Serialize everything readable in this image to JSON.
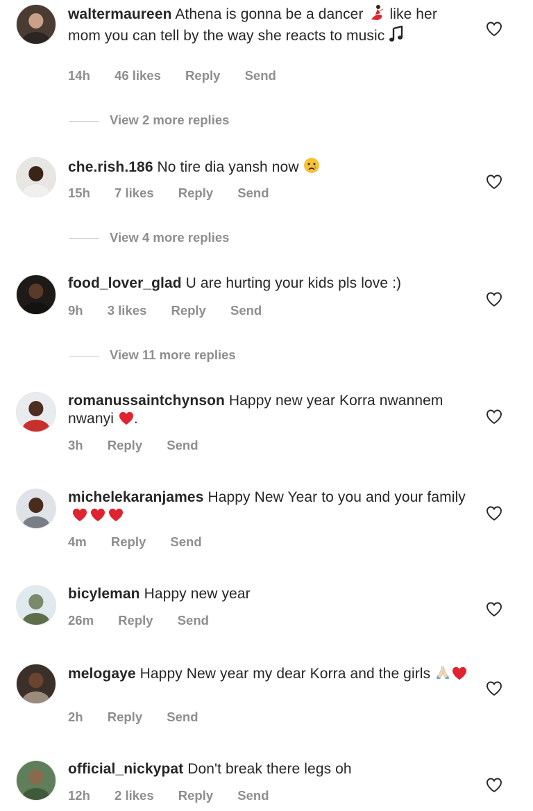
{
  "comments": [
    {
      "username": "waltermaureen",
      "text": "Athena is gonna be a dancer",
      "text_after_emoji": "like her mom  you  can tell by the way she reacts to music",
      "emoji": [
        "dancer-emoji",
        "music-note-emoji"
      ],
      "time": "14h",
      "likes": "46 likes",
      "reply": "Reply",
      "send": "Send",
      "view_replies": "View 2 more replies",
      "avatar_colors": {
        "bg": "#4a3b33",
        "head": "#c9a088",
        "body": "#2a2422"
      }
    },
    {
      "username": "che.rish.186",
      "text": "No tire dia yansh now",
      "emoji": [
        "crying-face-emoji"
      ],
      "time": "15h",
      "likes": "7 likes",
      "reply": "Reply",
      "send": "Send",
      "view_replies": "View 4 more replies",
      "avatar_colors": {
        "bg": "#e8e6e3",
        "head": "#3a2418",
        "body": "#f2f0ee"
      }
    },
    {
      "username": "food_lover_glad",
      "text": "U are hurting your kids pls love :)",
      "time": "9h",
      "likes": "3 likes",
      "reply": "Reply",
      "send": "Send",
      "view_replies": "View 11 more replies",
      "avatar_colors": {
        "bg": "#1e1a18",
        "head": "#5a3a2a",
        "body": "#141211"
      }
    },
    {
      "username": "romanussaintchynson",
      "text": "Happy new year Korra nwannem nwanyi",
      "text_after_emoji": ".",
      "emoji": [
        "red-heart-emoji"
      ],
      "time": "3h",
      "reply": "Reply",
      "send": "Send",
      "avatar_colors": {
        "bg": "#e9ecef",
        "head": "#4e2e20",
        "body": "#c8302c"
      }
    },
    {
      "username": "michelekaranjames",
      "text": "Happy New Year to you and your family",
      "emoji": [
        "red-heart-emoji",
        "red-heart-emoji",
        "red-heart-emoji"
      ],
      "time": "4m",
      "reply": "Reply",
      "send": "Send",
      "avatar_colors": {
        "bg": "#dfe3e8",
        "head": "#4a2c1e",
        "body": "#7a7f87"
      }
    },
    {
      "username": "bicyleman",
      "text": "Happy new year",
      "time": "26m",
      "reply": "Reply",
      "send": "Send",
      "avatar_colors": {
        "bg": "#dfe9ee",
        "head": "#7a8a6a",
        "body": "#5d6e4b"
      }
    },
    {
      "username": "melogaye",
      "text": "Happy New year my dear Korra and the girls",
      "emoji": [
        "folded-hands-emoji",
        "red-heart-emoji"
      ],
      "time": "2h",
      "reply": "Reply",
      "send": "Send",
      "avatar_colors": {
        "bg": "#3b2f2a",
        "head": "#6b4430",
        "body": "#9a8b7c"
      }
    },
    {
      "username": "official_nickypat",
      "text": "Don't break there legs oh",
      "time": "12h",
      "likes": "2 likes",
      "reply": "Reply",
      "send": "Send",
      "avatar_colors": {
        "bg": "#5e7f5a",
        "head": "#8a6a4e",
        "body": "#3f5a3a"
      }
    }
  ],
  "colors": {
    "text": "#262626",
    "muted": "#8e8e8e",
    "heart_stroke": "#262626",
    "emoji_red": "#e0242f"
  }
}
